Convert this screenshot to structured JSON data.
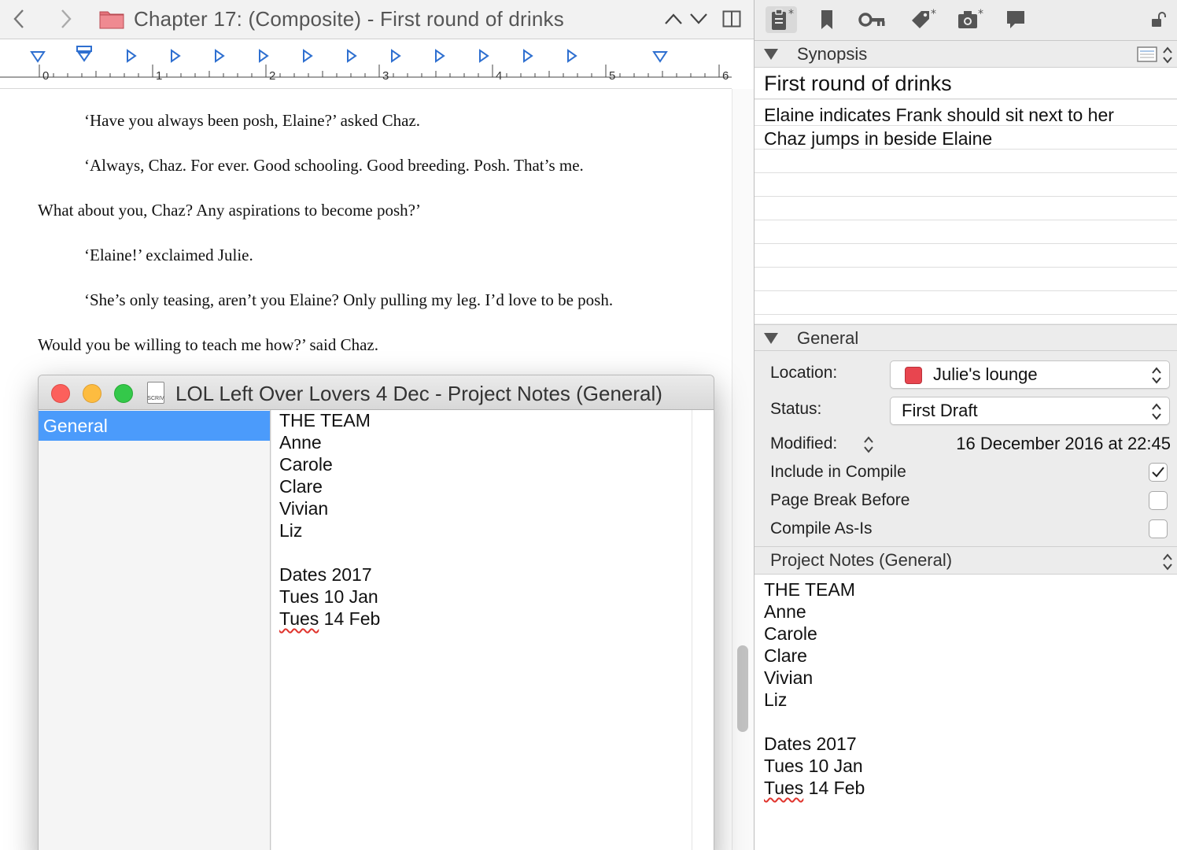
{
  "editor": {
    "title": "Chapter 17:  (Composite) - First round of drinks",
    "ruler_labels": [
      "0",
      "1",
      "2",
      "3",
      "4",
      "5",
      "6"
    ],
    "paragraphs": [
      "‘Have you always been posh, Elaine?’ asked Chaz.",
      "‘Always, Chaz. For ever. Good schooling. Good breeding. Posh. That’s me.",
      "What about you, Chaz? Any aspirations to become posh?’",
      "‘Elaine!’ exclaimed Julie.",
      "‘She’s only teasing, aren’t you Elaine? Only pulling my leg. I’d love to be posh.",
      "Would you be willing to teach me how?’ said Chaz."
    ]
  },
  "notes_window": {
    "title": "LOL Left Over Lovers  4 Dec - Project Notes (General)",
    "file_icon_text": "SCRIV",
    "sidebar_item": "General",
    "lines": [
      "THE TEAM",
      "Anne",
      "Carole",
      "Clare",
      "Vivian",
      "Liz",
      "",
      "Dates 2017",
      "Tues 10 Jan",
      "Tues 14 Feb"
    ],
    "last_line_word": "Tues",
    "last_line_rest": " 14 Feb"
  },
  "inspector": {
    "synopsis": {
      "header": "Synopsis",
      "title": "First round of drinks",
      "lines": [
        "Elaine indicates Frank should sit next to her",
        "Chaz jumps in beside Elaine"
      ]
    },
    "general": {
      "header": "General",
      "location_label": "Location:",
      "location_value": "Julie's lounge",
      "location_color": "#e8454f",
      "status_label": "Status:",
      "status_value": "First Draft",
      "modified_label": "Modified:",
      "modified_value": "16 December 2016 at 22:45",
      "include_label": "Include in Compile",
      "include_checked": true,
      "pagebreak_label": "Page Break Before",
      "pagebreak_checked": false,
      "asis_label": "Compile As-Is",
      "asis_checked": false
    },
    "project_notes": {
      "header": "Project Notes (General)",
      "lines": [
        "THE TEAM",
        "Anne",
        "Carole",
        "Clare",
        "Vivian",
        "Liz",
        "",
        "Dates 2017",
        "Tues 10 Jan"
      ],
      "last_line_word": "Tues",
      "last_line_rest": " 14 Feb"
    }
  },
  "colors": {
    "selection_blue": "#4b9bfb",
    "folder_red": "#e4727a",
    "ruler_marker_blue": "#2e6fd0",
    "close": "#fc605c",
    "minimize": "#fdbc40",
    "zoom": "#34c84a",
    "spell_error": "#e0342d"
  }
}
